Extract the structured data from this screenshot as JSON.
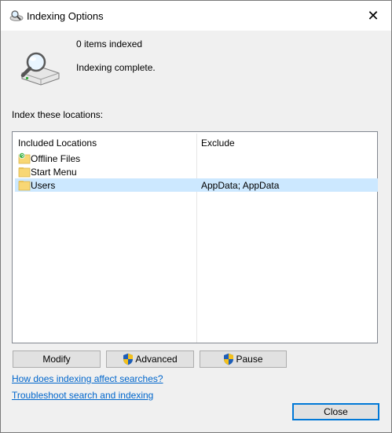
{
  "window": {
    "title": "Indexing Options",
    "close_glyph": "✕"
  },
  "status": {
    "items_indexed": "0 items indexed",
    "message": "Indexing complete."
  },
  "locations": {
    "label": "Index these locations:",
    "columns": [
      "Included Locations",
      "Exclude"
    ],
    "rows": [
      {
        "name": "Offline Files",
        "exclude": "",
        "icon": "offline-files-folder-icon",
        "selected": false
      },
      {
        "name": "Start Menu",
        "exclude": "",
        "icon": "folder-icon",
        "selected": false
      },
      {
        "name": "Users",
        "exclude": "AppData; AppData",
        "icon": "folder-icon",
        "selected": true
      }
    ]
  },
  "buttons": {
    "modify": "Modify",
    "advanced": "Advanced",
    "pause": "Pause",
    "close": "Close"
  },
  "links": {
    "how_indexing": "How does indexing affect searches?",
    "troubleshoot": "Troubleshoot search and indexing"
  },
  "colors": {
    "selection": "#cce8ff",
    "link": "#0066cc",
    "default_border": "#0078d7"
  }
}
